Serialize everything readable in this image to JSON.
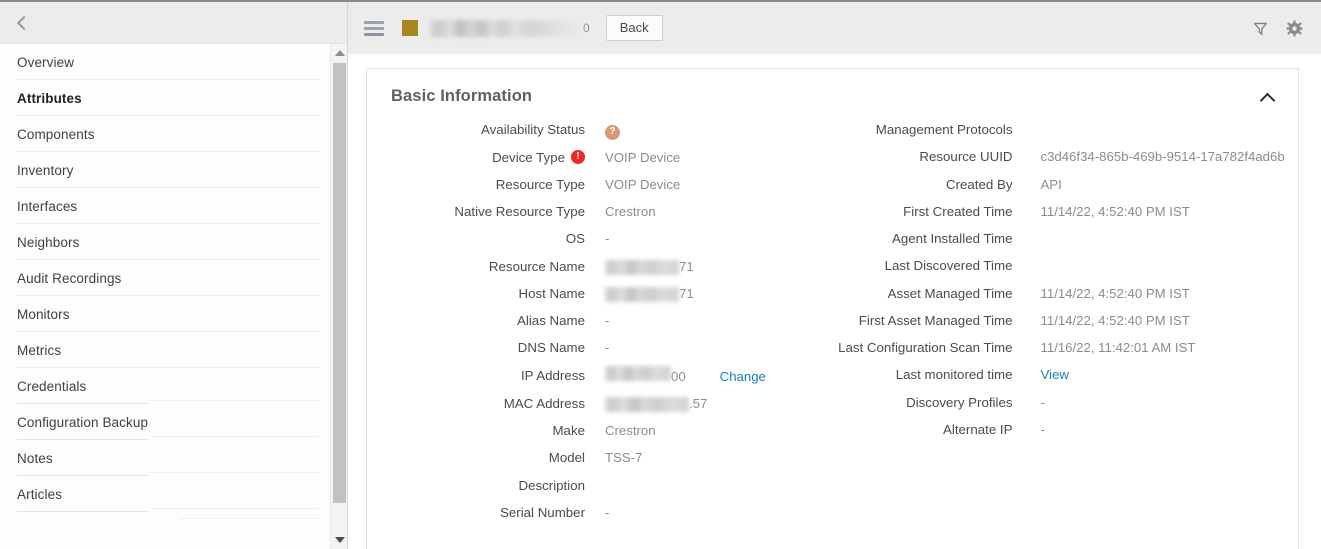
{
  "sidebar": {
    "collapse_icon": "chevron-left-icon",
    "items": [
      {
        "label": "Overview",
        "active": false
      },
      {
        "label": "Attributes",
        "active": true
      },
      {
        "label": "Components",
        "active": false
      },
      {
        "label": "Inventory",
        "active": false
      },
      {
        "label": "Interfaces",
        "active": false
      },
      {
        "label": "Neighbors",
        "active": false
      },
      {
        "label": "Audit Recordings",
        "active": false
      },
      {
        "label": "Monitors",
        "active": false
      },
      {
        "label": "Metrics",
        "active": false
      },
      {
        "label": "Credentials",
        "active": false
      },
      {
        "label": "Configuration Backup",
        "active": false
      },
      {
        "label": "Notes",
        "active": false
      },
      {
        "label": "Articles",
        "active": false
      }
    ]
  },
  "toolbar": {
    "menu_icon": "hamburger-menu-icon",
    "status_square_color": "#a8881e",
    "title_redacted": true,
    "title_suffix": "0",
    "back_label": "Back",
    "filter_icon": "funnel-filter-icon",
    "settings_icon": "gear-icon"
  },
  "card": {
    "title": "Basic Information",
    "collapse_icon": "chevron-up-icon"
  },
  "fields": {
    "left": [
      {
        "label": "Availability Status",
        "value": "",
        "icon": "question-circle-icon"
      },
      {
        "label": "Device Type",
        "value": "VOIP Device",
        "label_icon": "error-exclamation-icon"
      },
      {
        "label": "Resource Type",
        "value": "VOIP Device"
      },
      {
        "label": "Native Resource Type",
        "value": "Crestron"
      },
      {
        "label": "OS",
        "value": "-"
      },
      {
        "label": "Resource Name",
        "value": "71",
        "redacted": true
      },
      {
        "label": "Host Name",
        "value": "71",
        "redacted": true
      },
      {
        "label": "Alias Name",
        "value": "-"
      },
      {
        "label": "DNS Name",
        "value": "-"
      },
      {
        "label": "IP Address",
        "value": "00",
        "redacted": true,
        "action": "Change"
      },
      {
        "label": "MAC Address",
        "value": ".57",
        "redacted": true
      },
      {
        "label": "Make",
        "value": "Crestron"
      },
      {
        "label": "Model",
        "value": "TSS-7"
      },
      {
        "label": "Description",
        "value": ""
      },
      {
        "label": "Serial Number",
        "value": "-"
      }
    ],
    "right": [
      {
        "label": "Management Protocols",
        "value": ""
      },
      {
        "label": "Resource UUID",
        "value": "c3d46f34-865b-469b-9514-17a782f4ad6b"
      },
      {
        "label": "Created By",
        "value": "API"
      },
      {
        "label": "First Created Time",
        "value": "11/14/22, 4:52:40 PM IST"
      },
      {
        "label": "Agent Installed Time",
        "value": ""
      },
      {
        "label": "Last Discovered Time",
        "value": ""
      },
      {
        "label": "Asset Managed Time",
        "value": "11/14/22, 4:52:40 PM IST"
      },
      {
        "label": "First Asset Managed Time",
        "value": "11/14/22, 4:52:40 PM IST"
      },
      {
        "label": "Last Configuration Scan Time",
        "value": "11/16/22, 11:42:01 AM IST"
      },
      {
        "label": "Last monitored time",
        "value": "View",
        "is_link": true
      },
      {
        "label": "Discovery Profiles",
        "value": "-"
      },
      {
        "label": "Alternate IP",
        "value": "-"
      }
    ]
  },
  "colors": {
    "accent_link": "#1a7fc1",
    "badge_gold": "#a8881e",
    "error_red": "#f0252a",
    "unknown_tan": "#d79a72"
  }
}
